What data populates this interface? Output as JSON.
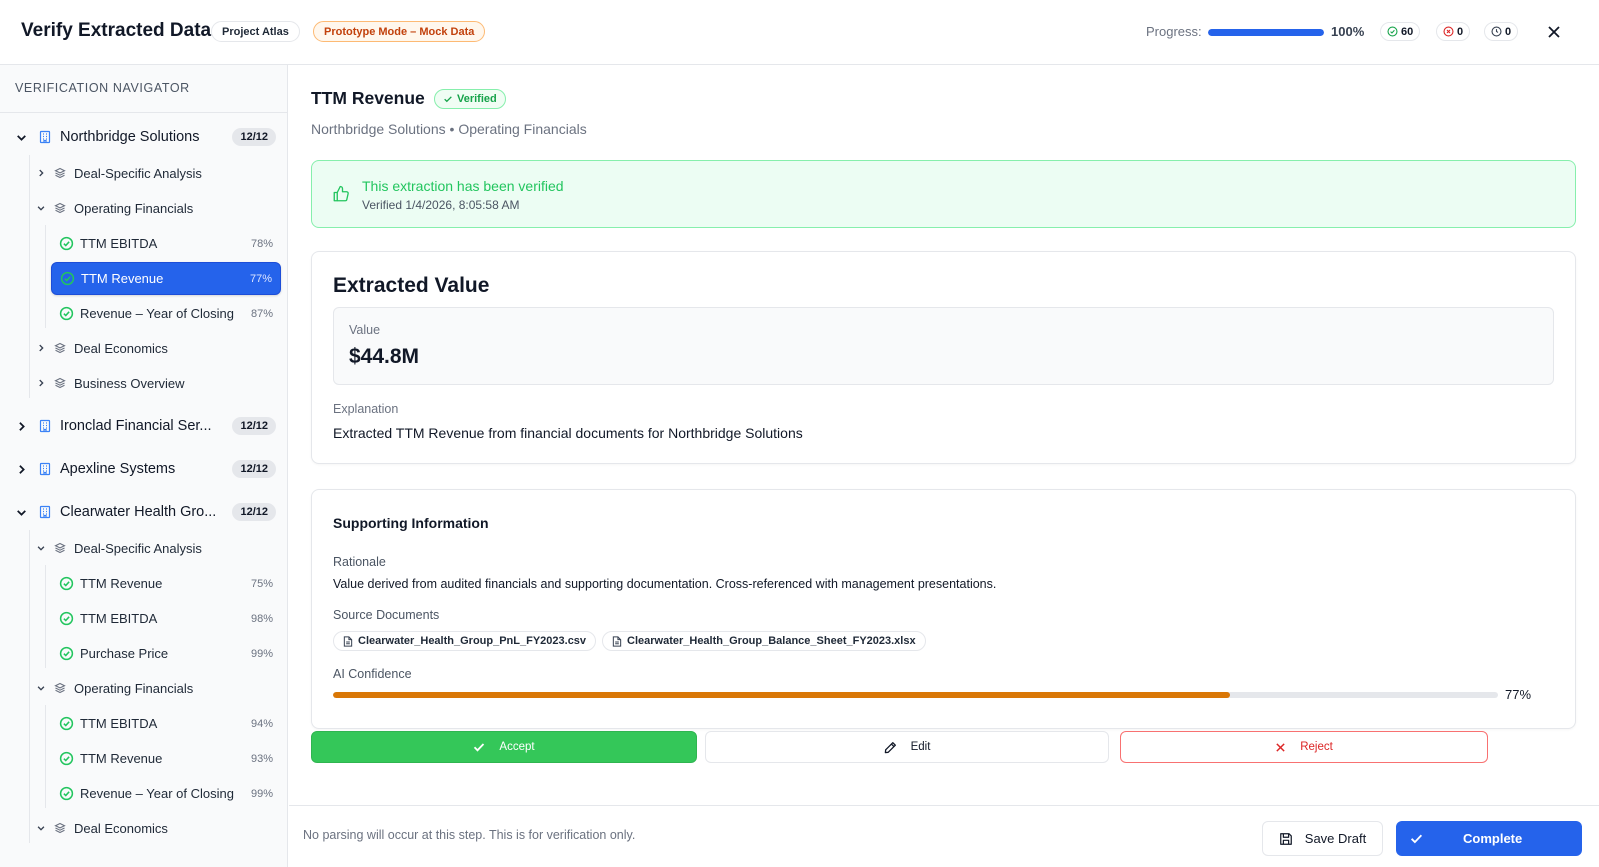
{
  "header": {
    "title": "Verify Extracted Data",
    "project_pill": "Project Atlas",
    "mode_pill": "Prototype Mode – Mock Data",
    "progress_label": "Progress:",
    "progress_value": 1.0,
    "progress_pct_text": "100%",
    "counts": {
      "verified": "60",
      "rejected": "0",
      "pending": "0"
    }
  },
  "sidebar": {
    "title": "VERIFICATION NAVIGATOR",
    "companies": [
      {
        "name": "Northbridge Solutions",
        "badge": "12/12",
        "expanded": true,
        "categories": [
          {
            "name": "Deal-Specific Analysis",
            "expanded": false,
            "fields": []
          },
          {
            "name": "Operating Financials",
            "expanded": true,
            "fields": [
              {
                "name": "TTM EBITDA",
                "pct": "78%",
                "active": false
              },
              {
                "name": "TTM Revenue",
                "pct": "77%",
                "active": true
              },
              {
                "name": "Revenue – Year of Closing",
                "pct": "87%",
                "active": false
              }
            ]
          },
          {
            "name": "Deal Economics",
            "expanded": false,
            "fields": []
          },
          {
            "name": "Business Overview",
            "expanded": false,
            "fields": []
          }
        ]
      },
      {
        "name": "Ironclad Financial Ser...",
        "badge": "12/12",
        "expanded": false,
        "categories": []
      },
      {
        "name": "Apexline Systems",
        "badge": "12/12",
        "expanded": false,
        "categories": []
      },
      {
        "name": "Clearwater Health Gro...",
        "badge": "12/12",
        "expanded": true,
        "categories": [
          {
            "name": "Deal-Specific Analysis",
            "expanded": true,
            "fields": [
              {
                "name": "TTM Revenue",
                "pct": "75%",
                "active": false
              },
              {
                "name": "TTM EBITDA",
                "pct": "98%",
                "active": false
              },
              {
                "name": "Purchase Price",
                "pct": "99%",
                "active": false
              }
            ]
          },
          {
            "name": "Operating Financials",
            "expanded": true,
            "fields": [
              {
                "name": "TTM EBITDA",
                "pct": "94%",
                "active": false
              },
              {
                "name": "TTM Revenue",
                "pct": "93%",
                "active": false
              },
              {
                "name": "Revenue – Year of Closing",
                "pct": "99%",
                "active": false
              }
            ]
          },
          {
            "name": "Deal Economics",
            "expanded": true,
            "fields": []
          }
        ]
      }
    ]
  },
  "main": {
    "title": "TTM Revenue",
    "verified_pill": "Verified",
    "breadcrumb": "Northbridge Solutions • Operating Financials",
    "banner": {
      "title": "This extraction has been verified",
      "subtitle": "Verified 1/4/2026, 8:05:58 AM"
    },
    "extracted": {
      "title": "Extracted Value",
      "value_label": "Value",
      "value": "$44.8M",
      "explanation_label": "Explanation",
      "explanation": "Extracted TTM Revenue from financial documents for Northbridge Solutions"
    },
    "support": {
      "title": "Supporting Information",
      "rationale_label": "Rationale",
      "rationale": "Value derived from audited financials and supporting documentation. Cross-referenced with management presentations.",
      "sources_label": "Source Documents",
      "sources": [
        "Clearwater_Health_Group_PnL_FY2023.csv",
        "Clearwater_Health_Group_Balance_Sheet_FY2023.xlsx"
      ],
      "confidence_label": "AI Confidence",
      "confidence_value": 0.77,
      "confidence_text": "77%"
    },
    "actions": {
      "accept": "Accept",
      "edit": "Edit",
      "reject": "Reject"
    }
  },
  "footer": {
    "note": "No parsing will occur at this step. This is for verification only.",
    "save_draft": "Save Draft",
    "complete": "Complete"
  },
  "colors": {
    "primary": "#2563eb",
    "success": "#34c759",
    "danger": "#dc2626",
    "confidence": "#d97706"
  }
}
